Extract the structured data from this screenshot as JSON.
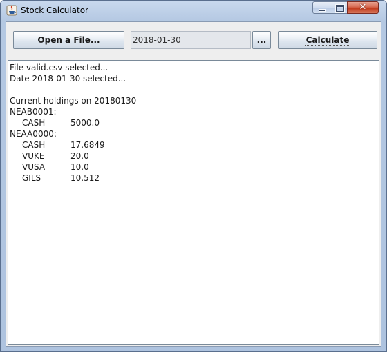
{
  "window": {
    "title": "Stock Calculator",
    "controls": [
      "minimize",
      "maximize",
      "close"
    ]
  },
  "toolbar": {
    "open_button_label": "Open a File...",
    "date_value": "2018-01-30",
    "browse_button_label": "...",
    "calculate_button_label": "Calculate"
  },
  "output": {
    "lines": [
      "File valid.csv selected...",
      "Date 2018-01-30 selected...",
      "",
      "Current holdings on 20180130"
    ],
    "accounts": [
      {
        "id": "NEAB0001:",
        "holdings": [
          {
            "name": "CASH",
            "value": "5000.0"
          }
        ]
      },
      {
        "id": "NEAA0000:",
        "holdings": [
          {
            "name": "CASH",
            "value": "17.6849"
          },
          {
            "name": "VUKE",
            "value": "20.0"
          },
          {
            "name": "VUSA",
            "value": "10.0"
          },
          {
            "name": "GILS",
            "value": "10.512"
          }
        ]
      }
    ]
  },
  "icons": {
    "app": "java-coffee-cup-icon"
  },
  "colors": {
    "frame": "#b4c8e2",
    "close_button": "#c1391b",
    "panel_bg": "#eeeeee",
    "output_bg": "#ffffff"
  }
}
